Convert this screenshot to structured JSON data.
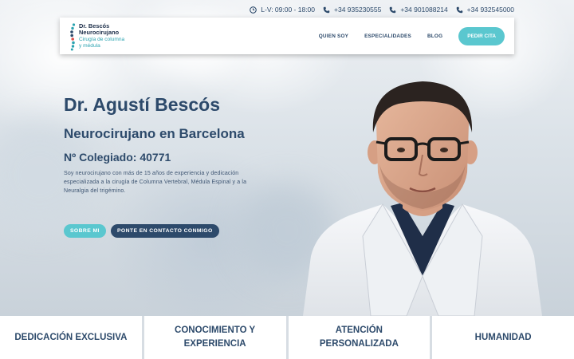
{
  "topbar": {
    "hours": "L-V: 09:00 - 18:00",
    "phones": [
      "+34 935230555",
      "+34 901088214",
      "+34 932545000"
    ]
  },
  "logo": {
    "line1": "Dr. Bescós",
    "line2": "Neurocirujano",
    "line3": "Cirugía de columna",
    "line4": "y médula"
  },
  "nav": {
    "items": [
      "QUIEN SOY",
      "ESPECIALIDADES",
      "BLOG"
    ],
    "cta": "PEDIR CITA"
  },
  "hero": {
    "title": "Dr. Agustí Bescós",
    "subtitle": "Neurocirujano en Barcelona",
    "colegiado": "Nº Colegiado: 40771",
    "description": "Soy neurocirujano con más de 15 años de experiencia y dedicación especializada a la cirugía de Columna Vertebral, Médula Espinal y a la Neuralgia del trigémino.",
    "button_primary": "SOBRE MI",
    "button_secondary": "PONTE EN CONTACTO CONMIGO"
  },
  "features": [
    "DEDICACIÓN EXCLUSIVA",
    "CONOCIMIENTO Y EXPERIENCIA",
    "ATENCIÓN PERSONALIZADA",
    "HUMANIDAD"
  ],
  "colors": {
    "primary": "#2d4a6b",
    "accent": "#5ac7cf",
    "logo_accent": "#2aa3b0"
  },
  "icons": {
    "hours": "clock-icon",
    "phone": "phone-icon",
    "logo": "spine-icon"
  }
}
